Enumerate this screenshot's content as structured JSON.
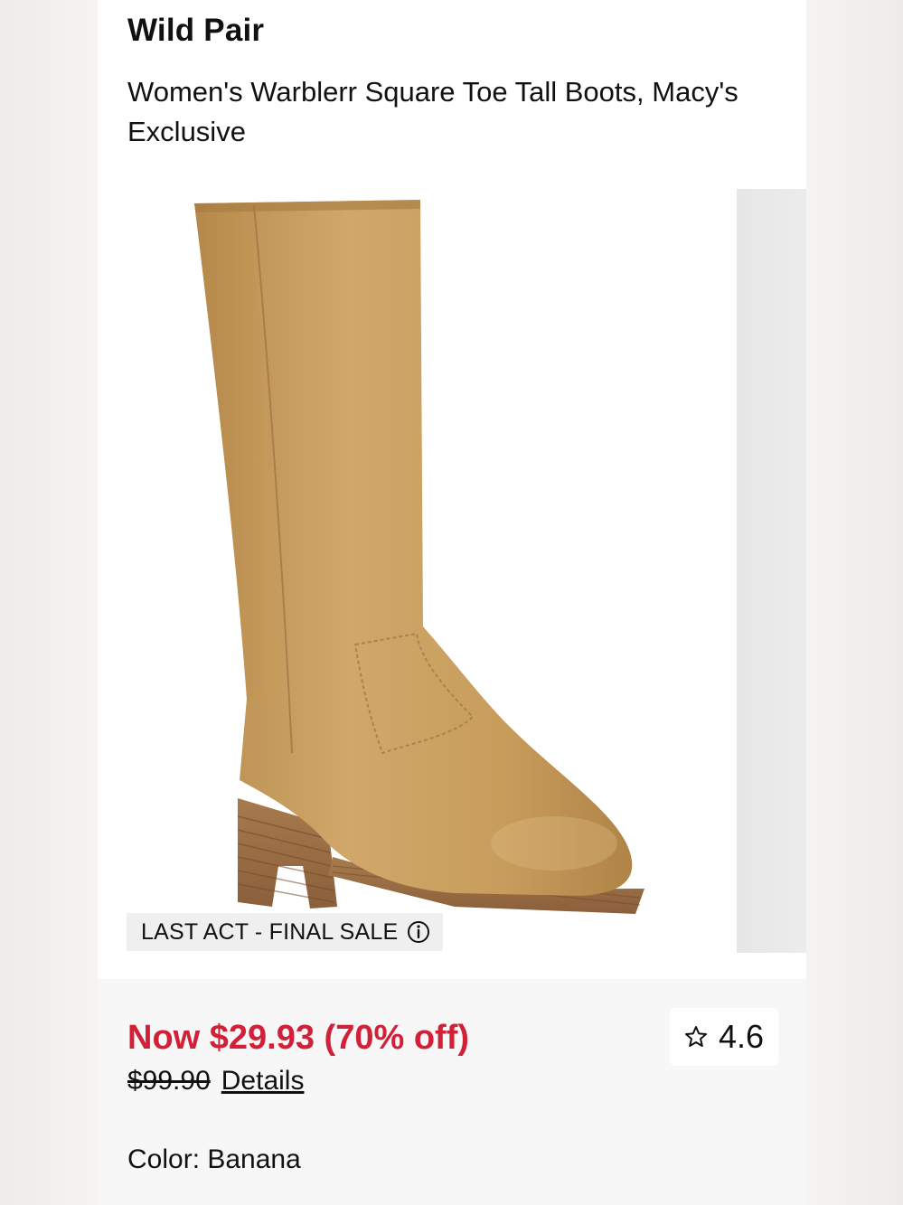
{
  "product": {
    "brand": "Wild Pair",
    "title": "Women's Warblerr Square Toe Tall Boots, Macy's Exclusive"
  },
  "image": {
    "icon": "tall-boot-product-image",
    "badge_text": "LAST ACT - FINAL SALE",
    "badge_icon": "info-icon"
  },
  "pricing": {
    "sale_price": "Now $29.93 (70% off)",
    "original_price": "$99.90",
    "details_label": "Details",
    "sale_color": "#d12138"
  },
  "rating": {
    "value": "4.6",
    "icon": "star-outline-icon"
  },
  "color": {
    "label": "Color: Banana"
  },
  "colors": {
    "boot_leather": "#c9a062",
    "sole_wood": "#9c7148"
  }
}
